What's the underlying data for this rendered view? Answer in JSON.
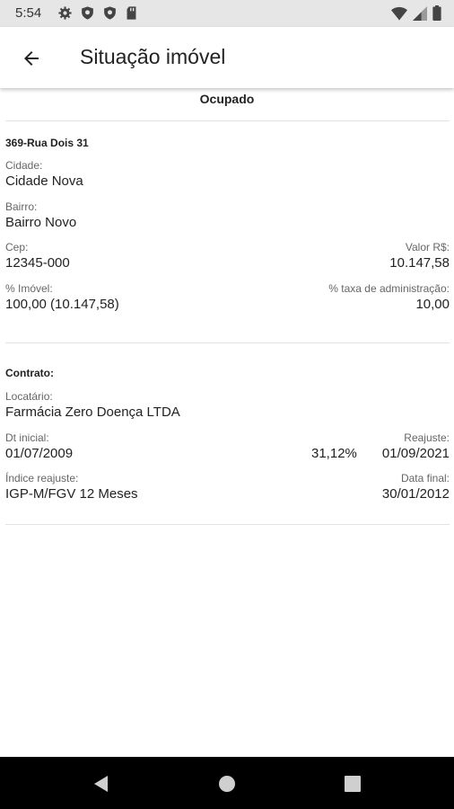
{
  "status_bar": {
    "time": "5:54",
    "icons": [
      "settings-icon",
      "shield-icon",
      "shield-icon",
      "sd-card-icon",
      "wifi-icon",
      "signal-icon",
      "battery-icon"
    ]
  },
  "app_bar": {
    "title": "Situação imóvel"
  },
  "property": {
    "status": "Ocupado",
    "address_title": "369-Rua Dois 31",
    "cidade_label": "Cidade:",
    "cidade_value": "Cidade Nova",
    "bairro_label": "Bairro:",
    "bairro_value": "Bairro Novo",
    "cep_label": "Cep:",
    "cep_value": "12345-000",
    "valor_label": "Valor R$:",
    "valor_value": "10.147,58",
    "pct_imovel_label": "% Imóvel:",
    "pct_imovel_value": "100,00 (10.147,58)",
    "taxa_label": "% taxa de administração:",
    "taxa_value": "10,00"
  },
  "contract": {
    "title": "Contrato:",
    "locatario_label": "Locatário:",
    "locatario_value": "Farmácia Zero Doença LTDA",
    "dt_inicial_label": "Dt inicial:",
    "dt_inicial_value": "01/07/2009",
    "reajuste_label": "Reajuste:",
    "reajuste_pct": "31,12%",
    "reajuste_date": "01/09/2021",
    "indice_label": "Índice reajuste:",
    "indice_value": "IGP-M/FGV 12 Meses",
    "data_final_label": "Data final:",
    "data_final_value": "30/01/2012"
  },
  "nav_bar": {
    "buttons": [
      "back-triangle-icon",
      "home-circle-icon",
      "recents-square-icon"
    ]
  }
}
